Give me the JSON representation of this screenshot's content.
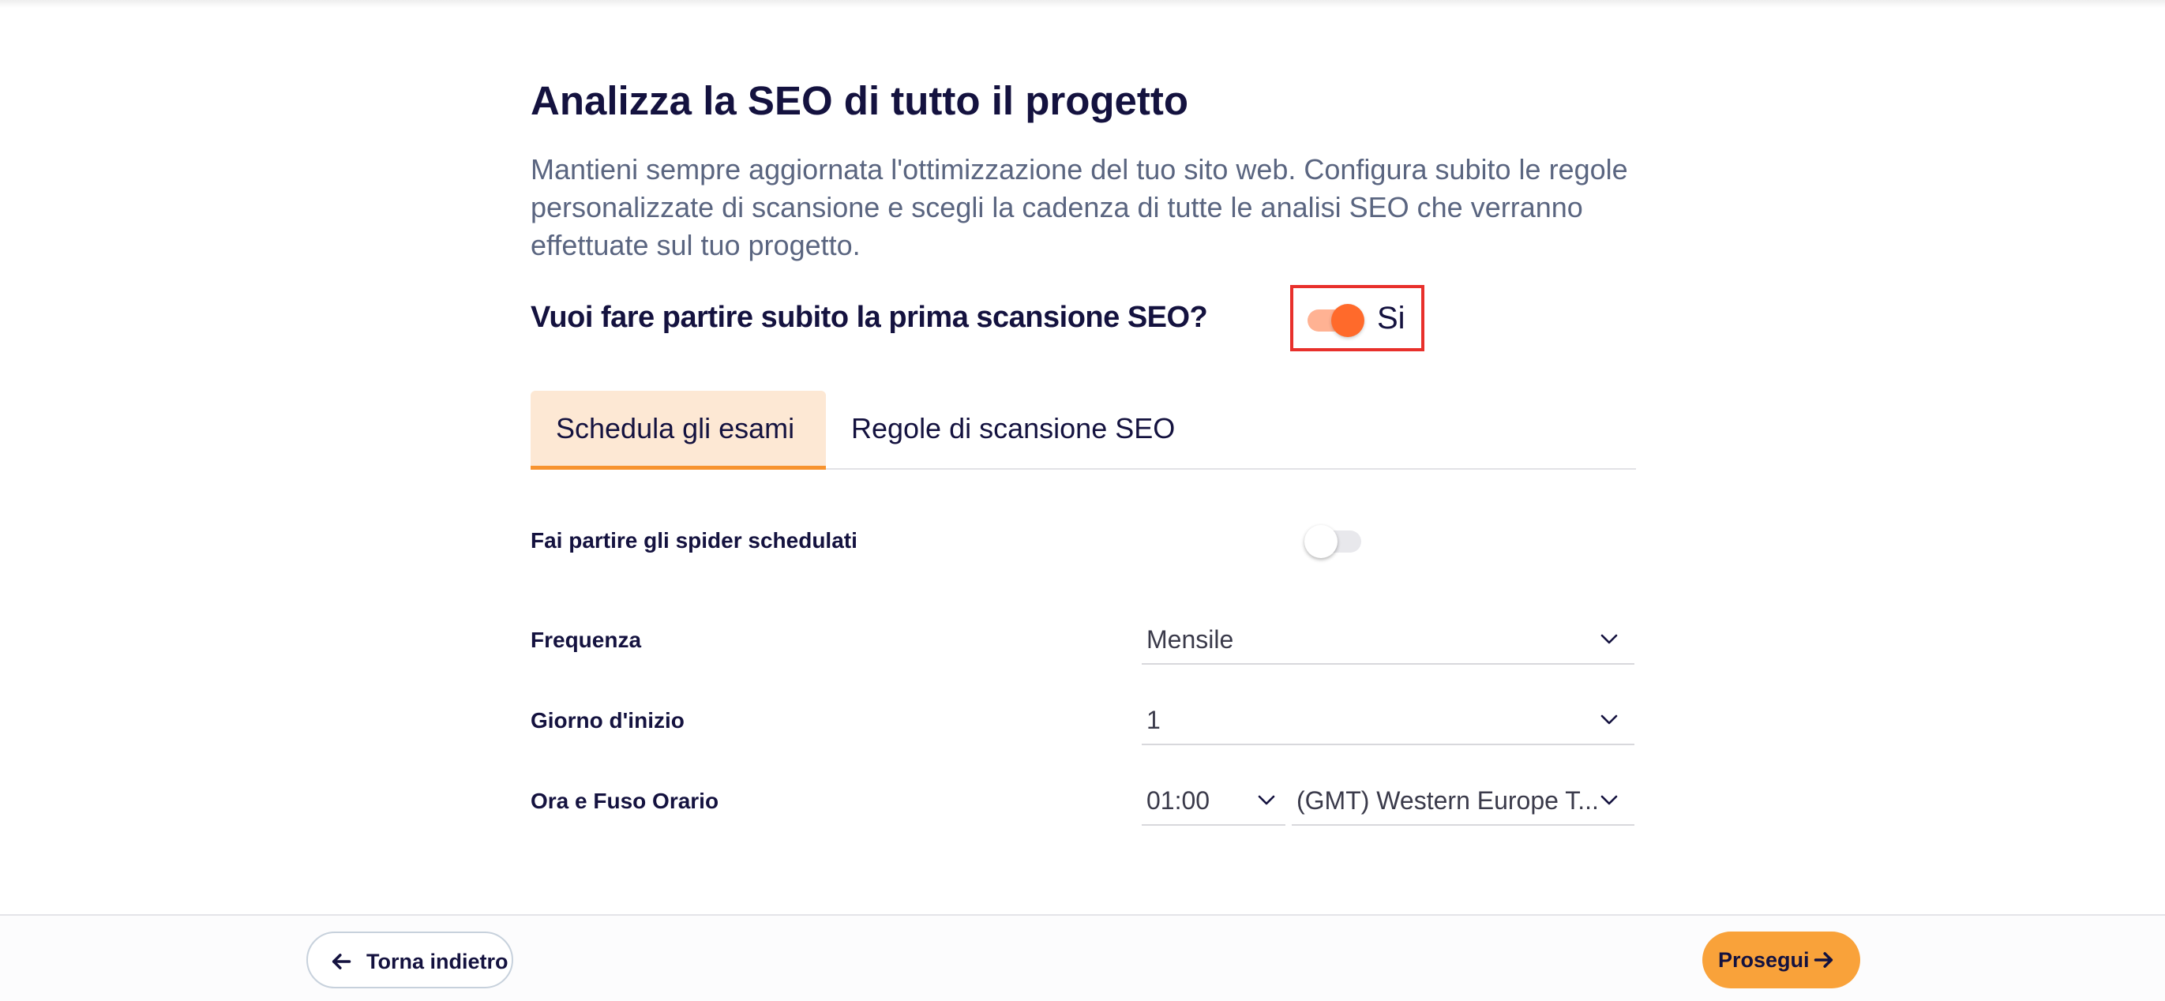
{
  "header": {
    "title": "Analizza la SEO di tutto il progetto",
    "description": "Mantieni sempre aggiornata l'ottimizzazione del tuo sito web. Configura subito le regole personalizzate di scansione e scegli la cadenza di tutte le analisi SEO che verranno effettuate sul tuo progetto."
  },
  "first_scan": {
    "question": "Vuoi fare partire subito la prima scansione SEO?",
    "toggle_on": true,
    "toggle_label": "Si"
  },
  "tabs": [
    {
      "label": "Schedula gli esami",
      "active": true
    },
    {
      "label": "Regole di scansione SEO",
      "active": false
    }
  ],
  "schedule": {
    "spider_label": "Fai partire gli spider schedulati",
    "spider_toggle_on": false,
    "frequency_label": "Frequenza",
    "frequency_value": "Mensile",
    "start_day_label": "Giorno d'inizio",
    "start_day_value": "1",
    "time_label": "Ora e Fuso Orario",
    "time_value": "01:00",
    "timezone_value": "(GMT) Western Europe T..."
  },
  "footer": {
    "back_label": "Torna indietro",
    "next_label": "Prosegui"
  },
  "colors": {
    "accent_orange": "#ff6a2b",
    "button_orange": "#f9a23a",
    "tab_active_bg": "#fde8d4",
    "highlight_red": "#e8302b",
    "text_dark": "#14123f"
  }
}
